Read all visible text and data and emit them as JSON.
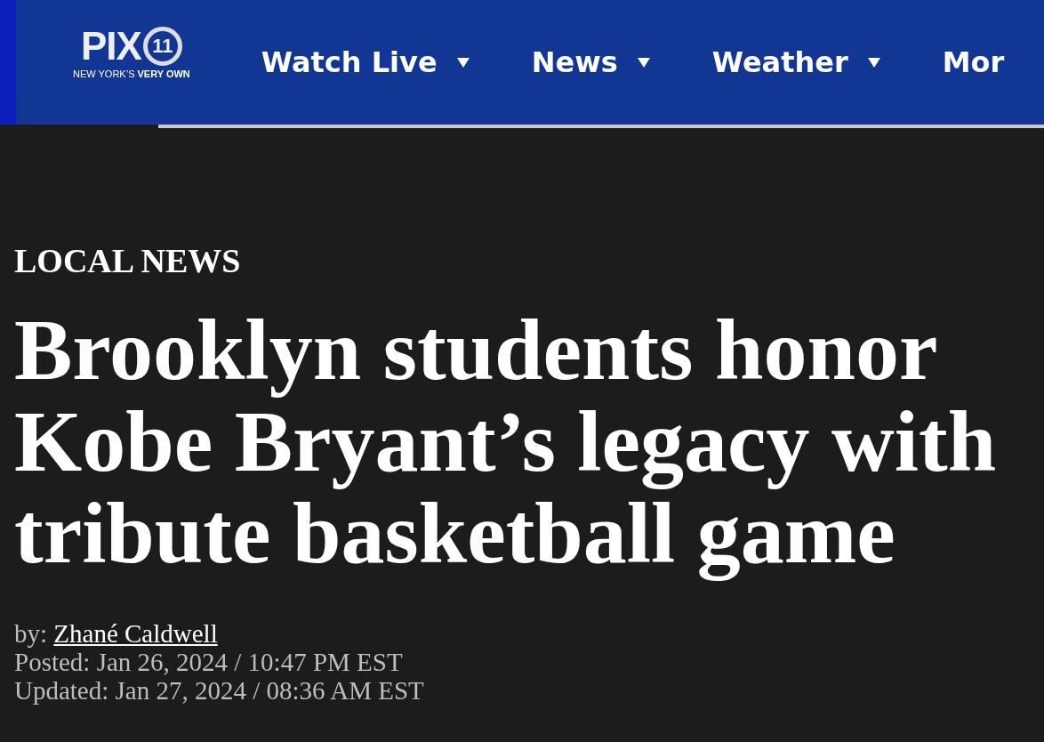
{
  "header": {
    "logo": {
      "wordmark": "PIX",
      "number": "11",
      "tagline_regular": "NEW YORK’S",
      "tagline_bold": "VERY OWN"
    },
    "nav": [
      {
        "label": "Watch Live",
        "dropdown": true
      },
      {
        "label": "News",
        "dropdown": true
      },
      {
        "label": "Weather",
        "dropdown": true
      },
      {
        "label": "Mor",
        "dropdown": false
      }
    ]
  },
  "article": {
    "category": "LOCAL NEWS",
    "headline": "Brooklyn students honor Kobe Bryant’s legacy with tribute basketball game",
    "byline_label": "by:",
    "author": "Zhané Caldwell",
    "posted": "Posted: Jan 26, 2024 / 10:47 PM EST",
    "updated": "Updated: Jan 27, 2024 / 08:36 AM EST"
  }
}
